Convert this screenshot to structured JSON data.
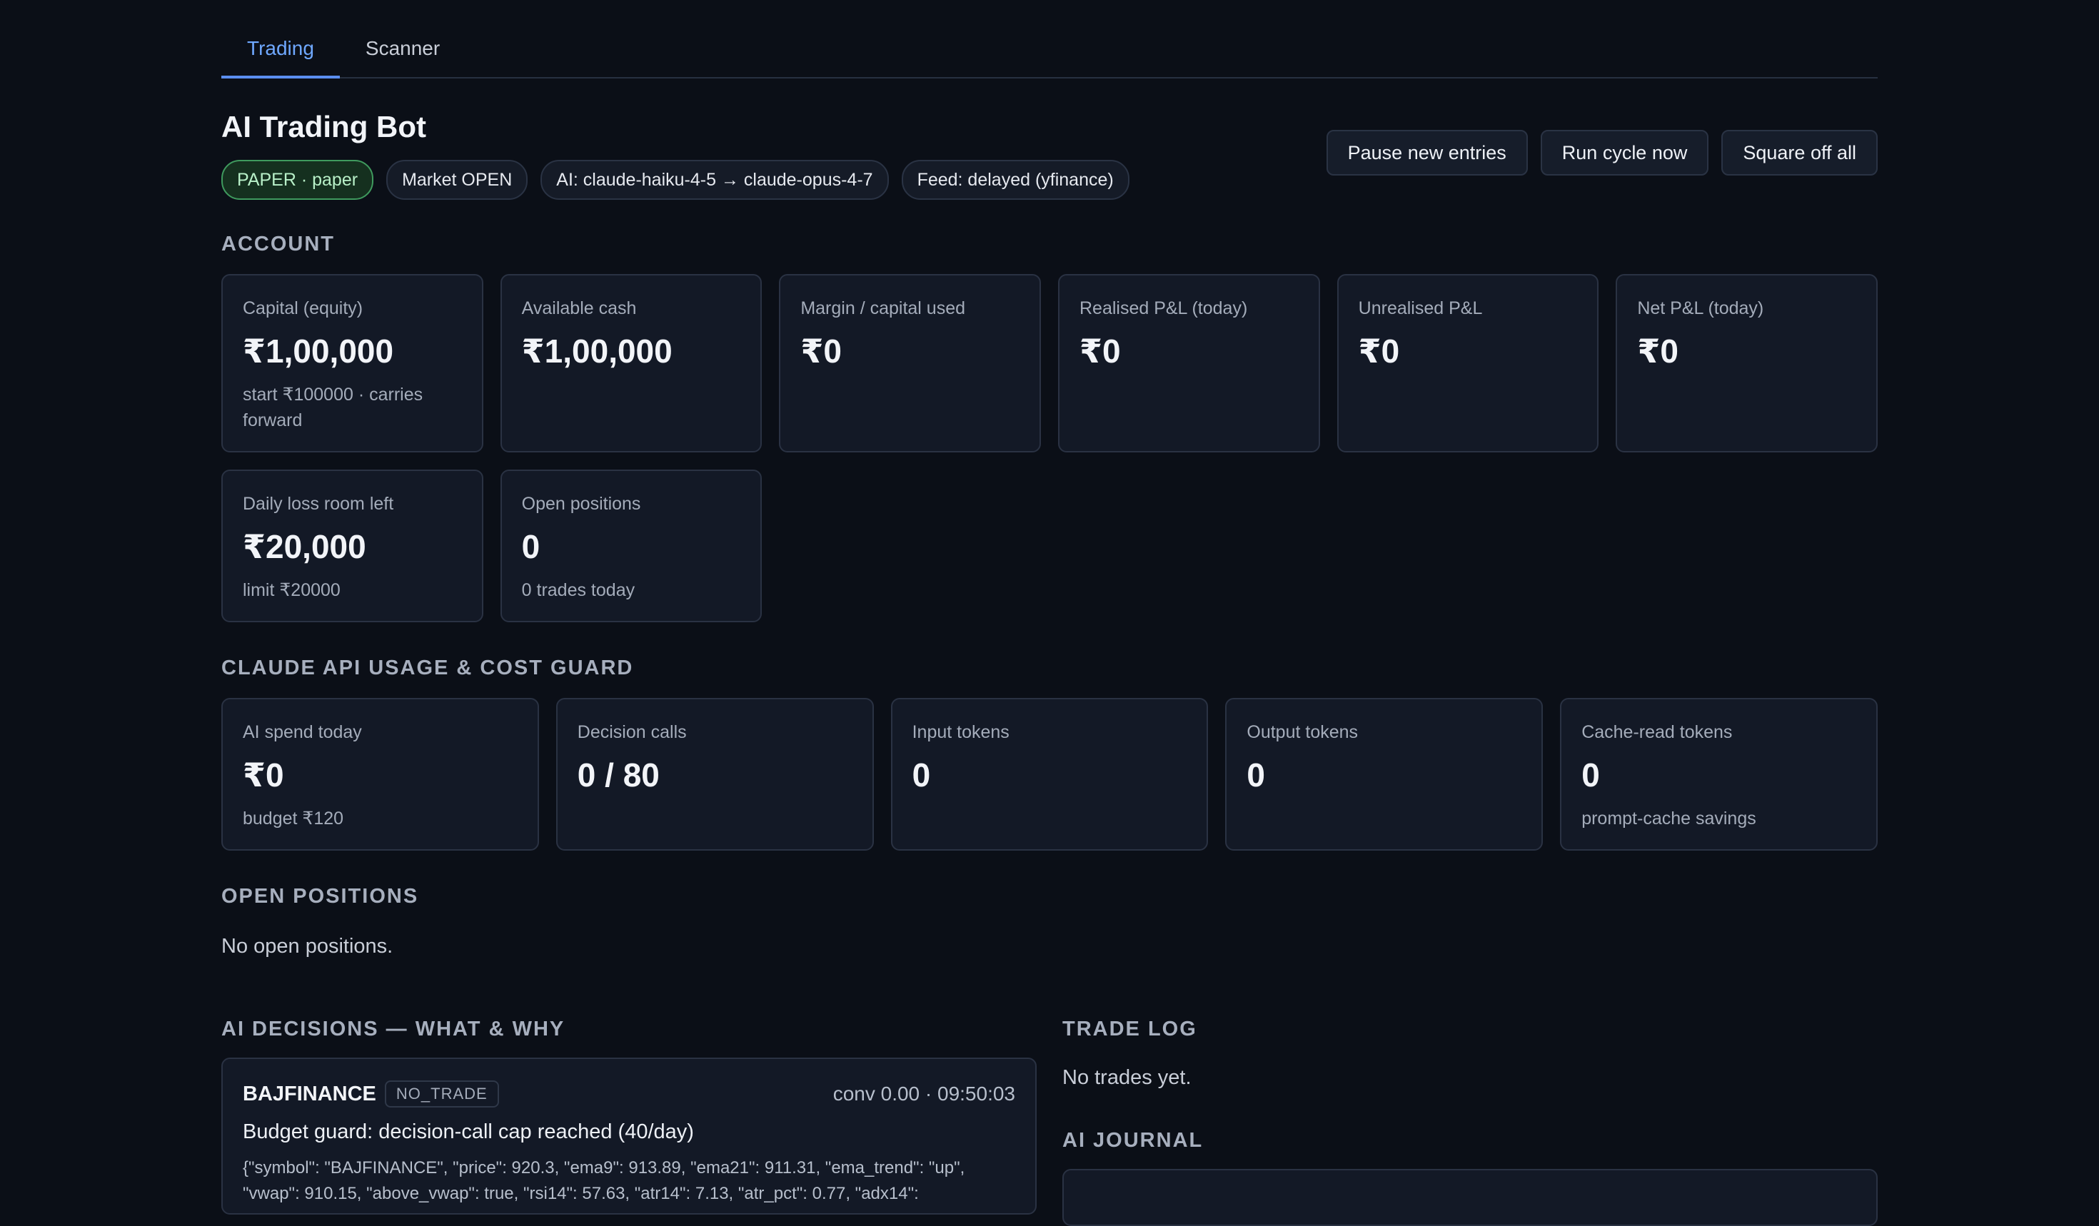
{
  "tabs": [
    {
      "label": "Trading",
      "active": true
    },
    {
      "label": "Scanner",
      "active": false
    }
  ],
  "header": {
    "title": "AI Trading Bot",
    "badges": {
      "mode": "PAPER · paper",
      "market": "Market OPEN",
      "ai": "AI: claude-haiku-4-5 → claude-opus-4-7",
      "feed": "Feed: delayed (yfinance)"
    },
    "actions": {
      "pause": "Pause new entries",
      "run": "Run cycle now",
      "square_off": "Square off all"
    }
  },
  "account": {
    "title": "ACCOUNT",
    "cards": [
      {
        "label": "Capital (equity)",
        "value": "₹1,00,000",
        "sub": "start ₹100000 · carries forward"
      },
      {
        "label": "Available cash",
        "value": "₹1,00,000",
        "sub": ""
      },
      {
        "label": "Margin / capital used",
        "value": "₹0",
        "sub": ""
      },
      {
        "label": "Realised P&L (today)",
        "value": "₹0",
        "sub": ""
      },
      {
        "label": "Unrealised P&L",
        "value": "₹0",
        "sub": ""
      },
      {
        "label": "Net P&L (today)",
        "value": "₹0",
        "sub": ""
      },
      {
        "label": "Daily loss room left",
        "value": "₹20,000",
        "sub": "limit ₹20000"
      },
      {
        "label": "Open positions",
        "value": "0",
        "sub": "0 trades today"
      }
    ]
  },
  "usage": {
    "title": "CLAUDE API USAGE & COST GUARD",
    "cards": [
      {
        "label": "AI spend today",
        "value": "₹0",
        "sub": "budget ₹120"
      },
      {
        "label": "Decision calls",
        "value": "0 / 80",
        "sub": ""
      },
      {
        "label": "Input tokens",
        "value": "0",
        "sub": ""
      },
      {
        "label": "Output tokens",
        "value": "0",
        "sub": ""
      },
      {
        "label": "Cache-read tokens",
        "value": "0",
        "sub": "prompt-cache savings"
      }
    ]
  },
  "positions": {
    "title": "OPEN POSITIONS",
    "empty": "No open positions."
  },
  "decisions": {
    "title": "AI DECISIONS — WHAT & WHY",
    "items": [
      {
        "symbol": "BAJFINANCE",
        "tag": "NO_TRADE",
        "meta": "conv 0.00 · 09:50:03",
        "reason": "Budget guard: decision-call cap reached (40/day)",
        "payload": "{\"symbol\": \"BAJFINANCE\", \"price\": 920.3, \"ema9\": 913.89, \"ema21\": 911.31, \"ema_trend\": \"up\", \"vwap\": 910.15, \"above_vwap\": true, \"rsi14\": 57.63, \"atr14\": 7.13, \"atr_pct\": 0.77, \"adx14\":"
      }
    ]
  },
  "trade_log": {
    "title": "TRADE LOG",
    "empty": "No trades yet."
  },
  "journal": {
    "title": "AI JOURNAL"
  }
}
